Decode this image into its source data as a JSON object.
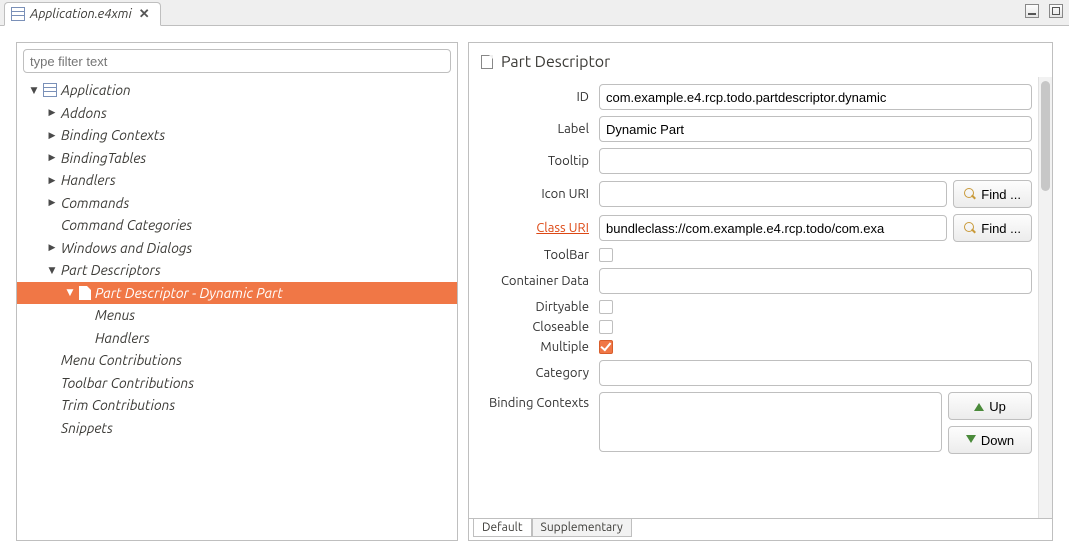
{
  "tab": {
    "title": "Application.e4xmi"
  },
  "filter": {
    "placeholder": "type filter text"
  },
  "tree": {
    "root": "Application",
    "addons": "Addons",
    "binding_contexts": "Binding Contexts",
    "binding_tables": "BindingTables",
    "handlers": "Handlers",
    "commands": "Commands",
    "command_categories": "Command Categories",
    "windows_dialogs": "Windows and Dialogs",
    "part_descriptors": "Part Descriptors",
    "selected": "Part Descriptor - Dynamic Part",
    "pd_menus": "Menus",
    "pd_handlers": "Handlers",
    "menu_contrib": "Menu Contributions",
    "toolbar_contrib": "Toolbar Contributions",
    "trim_contrib": "Trim Contributions",
    "snippets": "Snippets"
  },
  "header": {
    "title": "Part Descriptor"
  },
  "labels": {
    "id": "ID",
    "label": "Label",
    "tooltip": "Tooltip",
    "iconuri": "Icon URI",
    "classuri": "Class URI",
    "toolbar": "ToolBar",
    "containerdata": "Container Data",
    "dirtyable": "Dirtyable",
    "closeable": "Closeable",
    "multiple": "Multiple",
    "category": "Category",
    "bindingcontexts": "Binding Contexts"
  },
  "values": {
    "id": "com.example.e4.rcp.todo.partdescriptor.dynamic",
    "label": "Dynamic Part",
    "tooltip": "",
    "iconuri": "",
    "classuri": "bundleclass://com.example.e4.rcp.todo/com.exa",
    "containerdata": "",
    "category": ""
  },
  "buttons": {
    "find": "Find ...",
    "up": "Up",
    "down": "Down"
  },
  "bottomTabs": {
    "default": "Default",
    "supplementary": "Supplementary"
  }
}
